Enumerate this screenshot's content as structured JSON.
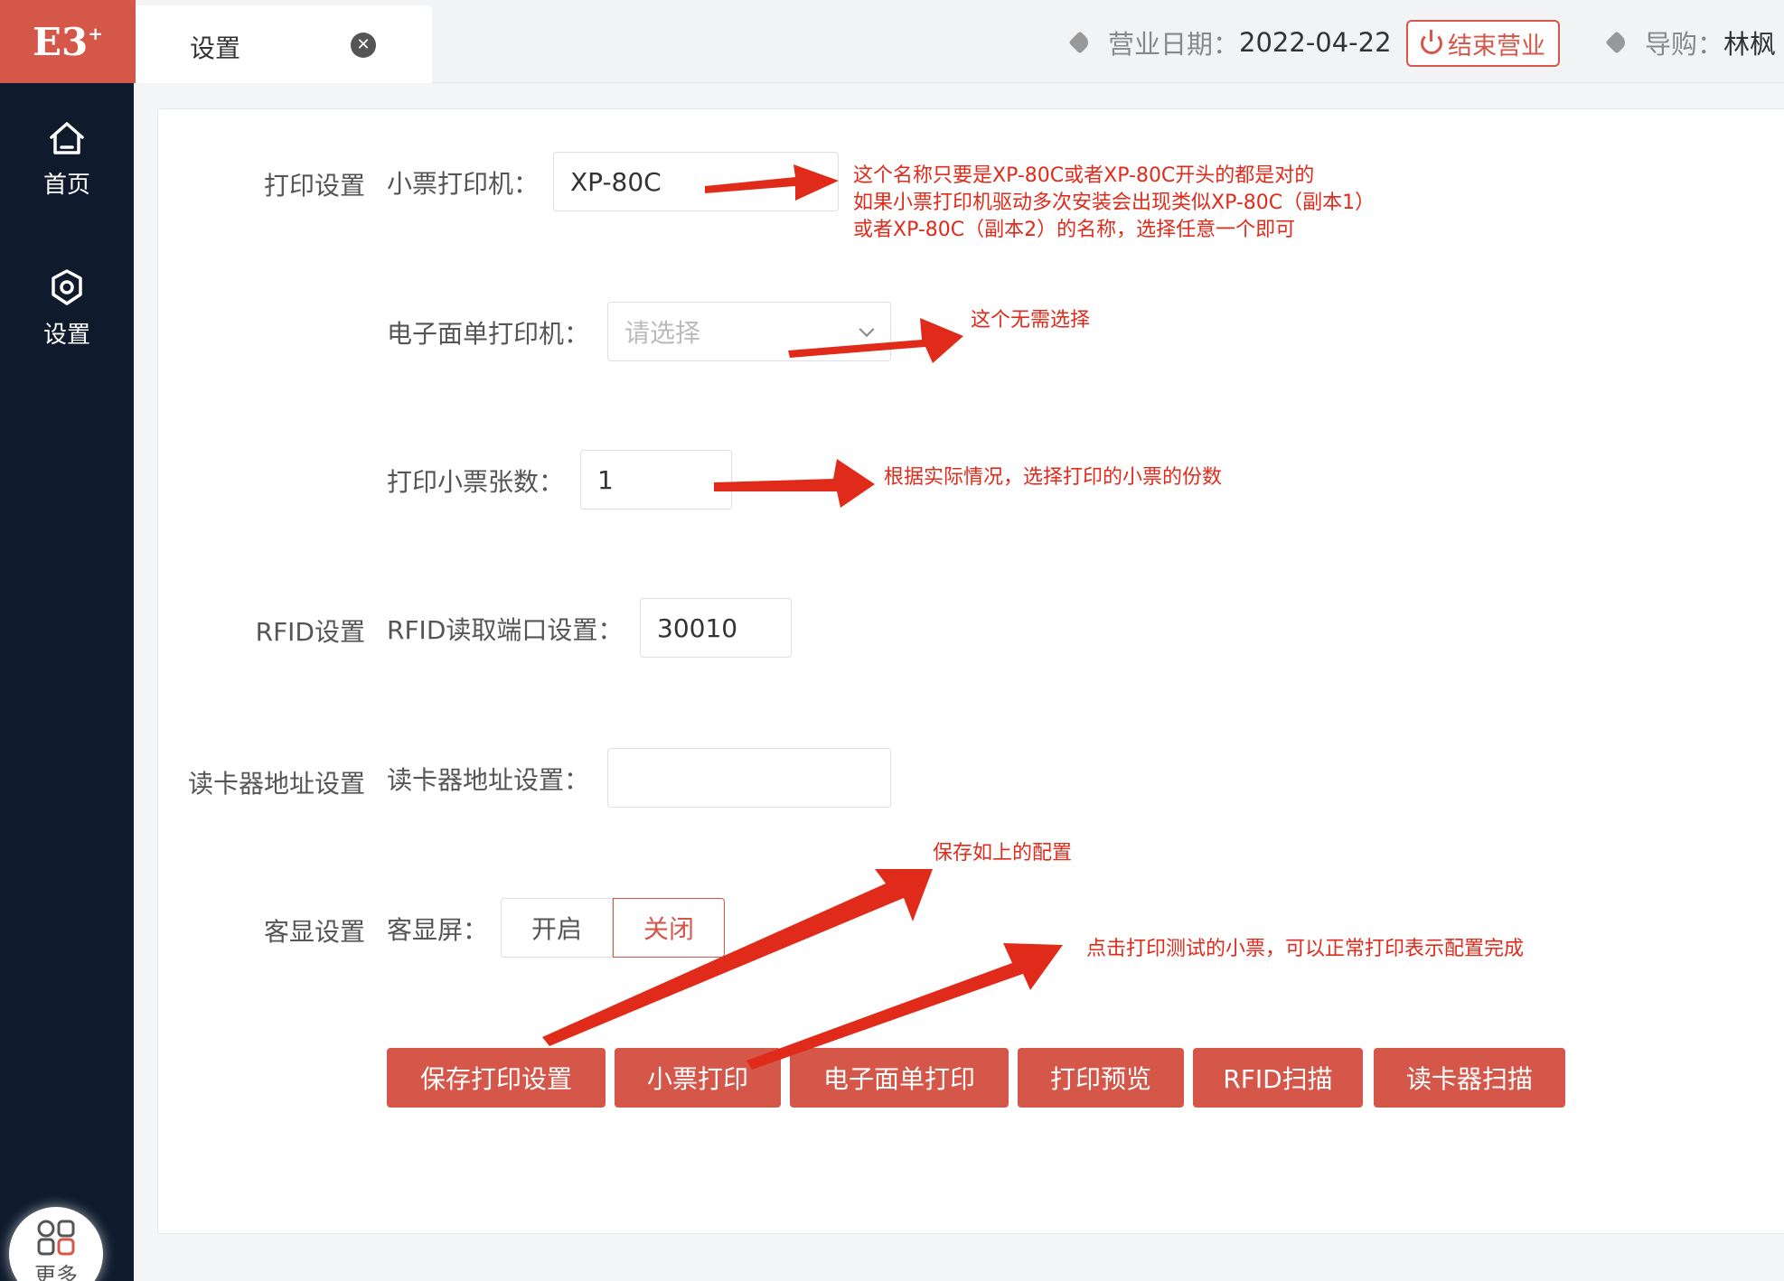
{
  "header": {
    "logo_text": "E3",
    "logo_sup": "+",
    "tab_label": "设置",
    "business_date_label": "营业日期：",
    "business_date_value": "2022-04-22",
    "end_business_label": "结束营业",
    "guide_label": "导购：",
    "guide_value": "林枫"
  },
  "sidebar": {
    "items": [
      {
        "label": "首页",
        "icon": "home-icon"
      },
      {
        "label": "设置",
        "icon": "gear-icon"
      }
    ],
    "more_label": "更多"
  },
  "sections": {
    "print": "打印设置",
    "rfid": "RFID设置",
    "card_reader": "读卡器地址设置",
    "display": "客显设置"
  },
  "fields": {
    "ticket_printer_label": "小票打印机：",
    "ticket_printer_value": "XP-80C",
    "eform_printer_label": "电子面单打印机：",
    "eform_printer_placeholder": "请选择",
    "ticket_copies_label": "打印小票张数：",
    "ticket_copies_value": "1",
    "rfid_port_label": "RFID读取端口设置：",
    "rfid_port_value": "30010",
    "card_reader_label": "读卡器地址设置：",
    "card_reader_value": "",
    "customer_display_label": "客显屏：",
    "display_on": "开启",
    "display_off": "关闭"
  },
  "buttons": {
    "save": "保存打印设置",
    "ticket_print": "小票打印",
    "eform_print": "电子面单打印",
    "preview": "打印预览",
    "rfid_scan": "RFID扫描",
    "card_scan": "读卡器扫描"
  },
  "annotations": {
    "printer_note_1": "这个名称只要是XP-80C或者XP-80C开头的都是对的",
    "printer_note_2": "如果小票打印机驱动多次安装会出现类似XP-80C（副本1）",
    "printer_note_3": "或者XP-80C（副本2）的名称，选择任意一个即可",
    "eform_note": "这个无需选择",
    "copies_note": "根据实际情况，选择打印的小票的份数",
    "save_note": "保存如上的配置",
    "test_note": "点击打印测试的小票，可以正常打印表示配置完成"
  },
  "colors": {
    "accent": "#d4574a",
    "sidebar": "#0f1b2d",
    "annotation": "#e02b1b"
  }
}
